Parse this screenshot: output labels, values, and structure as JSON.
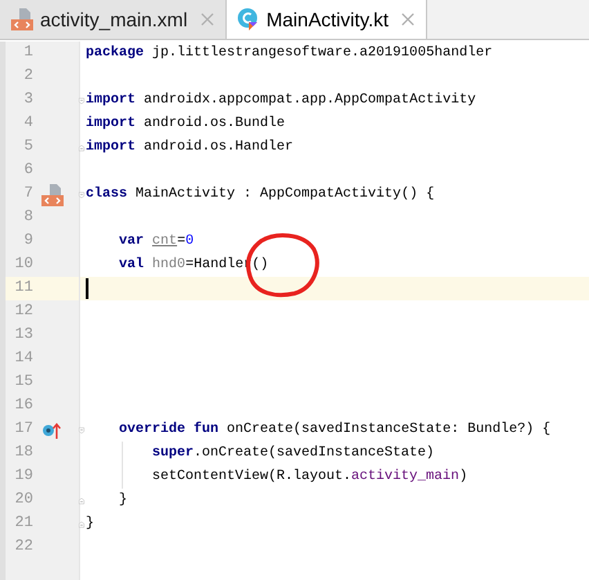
{
  "tabs": [
    {
      "label": "activity_main.xml",
      "selected": false,
      "kind": "xml"
    },
    {
      "label": "MainActivity.kt",
      "selected": true,
      "kind": "kotlin"
    }
  ],
  "lines": [
    {
      "number": "1",
      "tokens": [
        {
          "text": "package",
          "kind": "keyword"
        },
        {
          "text": " jp.littlestrangesoftware.a20191005handler",
          "kind": "plain"
        }
      ]
    },
    {
      "number": "2"
    },
    {
      "number": "3",
      "fold": {
        "kind": "start"
      },
      "tokens": [
        {
          "text": "import",
          "kind": "keyword"
        },
        {
          "text": " androidx.appcompat.app.AppCompatActivity",
          "kind": "plain"
        }
      ]
    },
    {
      "number": "4",
      "tokens": [
        {
          "text": "import",
          "kind": "keyword"
        },
        {
          "text": " android.os.Bundle",
          "kind": "plain"
        }
      ]
    },
    {
      "number": "5",
      "fold": {
        "kind": "end"
      },
      "tokens": [
        {
          "text": "import",
          "kind": "keyword"
        },
        {
          "text": " android.os.Handler",
          "kind": "plain"
        }
      ]
    },
    {
      "number": "6"
    },
    {
      "number": "7",
      "fold": {
        "kind": "start"
      },
      "gutter": {
        "kind": "xml"
      },
      "tokens": [
        {
          "text": "class",
          "kind": "keyword"
        },
        {
          "text": " MainActivity : AppCompatActivity() {",
          "kind": "plain"
        }
      ]
    },
    {
      "number": "8"
    },
    {
      "number": "9",
      "tokens": [
        {
          "text": "    var",
          "kind": "keyword"
        },
        {
          "text": " cnt",
          "kind": "unused_var"
        },
        {
          "text": "=",
          "kind": "plain"
        },
        {
          "text": "0",
          "kind": "number"
        }
      ]
    },
    {
      "number": "10",
      "tokens": [
        {
          "text": "    val",
          "kind": "keyword"
        },
        {
          "text": " hnd0",
          "kind": "unused"
        },
        {
          "text": "=Handler()",
          "kind": "plain"
        }
      ]
    },
    {
      "number": "11",
      "current": true,
      "caret": true
    },
    {
      "number": "12"
    },
    {
      "number": "13"
    },
    {
      "number": "14"
    },
    {
      "number": "15"
    },
    {
      "number": "16"
    },
    {
      "number": "17",
      "fold": {
        "kind": "start"
      },
      "gutter": {
        "kind": "override"
      },
      "tokens": [
        {
          "text": "    override fun",
          "kind": "keyword"
        },
        {
          "text": " onCreate(savedInstanceState: Bundle?) {",
          "kind": "plain"
        }
      ]
    },
    {
      "number": "18",
      "indent_guide": true,
      "tokens": [
        {
          "text": "        super",
          "kind": "keyword"
        },
        {
          "text": ".onCreate(savedInstanceState)",
          "kind": "plain"
        }
      ]
    },
    {
      "number": "19",
      "indent_guide": true,
      "tokens": [
        {
          "text": "        setContentView(R.layout.",
          "kind": "plain"
        },
        {
          "text": "activity_main",
          "kind": "field"
        },
        {
          "text": ")",
          "kind": "plain"
        }
      ]
    },
    {
      "number": "20",
      "fold": {
        "kind": "end"
      },
      "tokens": [
        {
          "text": "    }",
          "kind": "plain"
        }
      ]
    },
    {
      "number": "21",
      "fold": {
        "kind": "end"
      },
      "tokens": [
        {
          "text": "}",
          "kind": "plain"
        }
      ]
    },
    {
      "number": "22"
    }
  ]
}
